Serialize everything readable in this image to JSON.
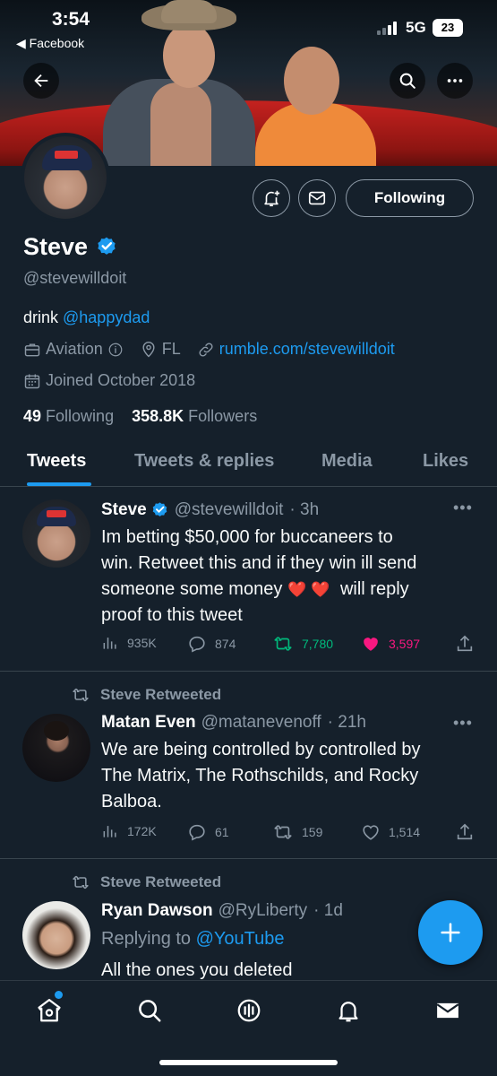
{
  "status_bar": {
    "time": "3:54",
    "back_app": "◀ Facebook",
    "network": "5G",
    "battery": "23"
  },
  "profile": {
    "name": "Steve",
    "handle": "@stevewilldoit",
    "bio_text": "drink ",
    "bio_link": "@happydad",
    "category": "Aviation",
    "location": "FL",
    "website": "rumble.com/stevewilldoit",
    "joined": "Joined October 2018",
    "following_count": "49",
    "following_label": "Following",
    "followers_count": "358.8K",
    "followers_label": "Followers",
    "follow_button": "Following"
  },
  "tabs": [
    {
      "label": "Tweets",
      "active": true
    },
    {
      "label": "Tweets & replies",
      "active": false
    },
    {
      "label": "Media",
      "active": false
    },
    {
      "label": "Likes",
      "active": false
    }
  ],
  "tweets": [
    {
      "name": "Steve",
      "handle": "@stevewilldoit",
      "time": "· 3h",
      "text_line1": "Im betting $50,000 for buccaneers to",
      "text_line2": "win. Retweet this and if they win ill send",
      "text_line3a": "someone some money",
      "hearts": "❤️ ❤️",
      "text_line3b": "will reply",
      "text_line4": "proof to this tweet",
      "views": "935K",
      "replies": "874",
      "retweets": "7,780",
      "likes": "3,597"
    },
    {
      "retweeted_by": "Steve Retweeted",
      "name": "Matan Even",
      "handle": "@matanevenoff",
      "time": "· 21h",
      "text_line1": "We are being controlled by controlled by",
      "text_line2": "The Matrix, The Rothschilds, and Rocky",
      "text_line3": "Balboa.",
      "views": "172K",
      "replies": "61",
      "retweets": "159",
      "likes": "1,514"
    },
    {
      "retweeted_by": "Steve Retweeted",
      "name": "Ryan Dawson",
      "handle": "@RyLiberty",
      "time": "· 1d",
      "replying_prefix": "Replying to ",
      "replying_to": "@YouTube",
      "text_line1": "All the ones you deleted"
    }
  ],
  "colors": {
    "accent": "#1d9bf0",
    "retweet_active": "#00ba7c",
    "like_active": "#f91880",
    "background": "#15202b"
  },
  "icons": [
    "back-arrow-icon",
    "search-icon",
    "more-icon",
    "add-notification-icon",
    "message-icon",
    "verified-icon",
    "briefcase-icon",
    "info-icon",
    "location-icon",
    "link-icon",
    "calendar-icon",
    "views-icon",
    "reply-icon",
    "retweet-icon",
    "like-icon",
    "share-icon",
    "compose-icon",
    "home-icon",
    "spaces-icon",
    "bell-icon",
    "mail-icon"
  ]
}
